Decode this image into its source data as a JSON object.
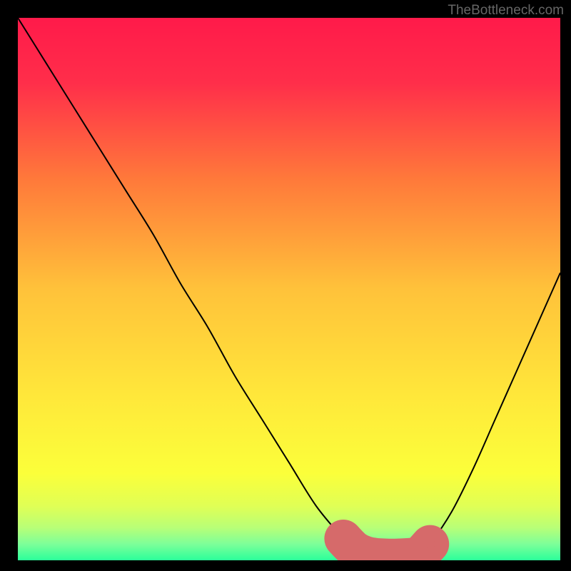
{
  "watermark": "TheBottleneck.com",
  "chart_data": {
    "type": "line",
    "title": "",
    "xlabel": "",
    "ylabel": "",
    "xlim": [
      0,
      100
    ],
    "ylim": [
      0,
      100
    ],
    "background_gradient": {
      "stops": [
        {
          "pos": 0.0,
          "color": "#ff1a4a"
        },
        {
          "pos": 0.12,
          "color": "#ff2e4a"
        },
        {
          "pos": 0.3,
          "color": "#ff7a3a"
        },
        {
          "pos": 0.5,
          "color": "#ffc23a"
        },
        {
          "pos": 0.7,
          "color": "#ffe83a"
        },
        {
          "pos": 0.84,
          "color": "#fbff3a"
        },
        {
          "pos": 0.9,
          "color": "#e0ff55"
        },
        {
          "pos": 0.94,
          "color": "#b8ff77"
        },
        {
          "pos": 0.97,
          "color": "#7dff99"
        },
        {
          "pos": 1.0,
          "color": "#2bff9a"
        }
      ]
    },
    "series": [
      {
        "name": "bottleneck-curve",
        "color": "#000000",
        "width": 2,
        "x": [
          0,
          5,
          10,
          15,
          20,
          25,
          30,
          35,
          40,
          45,
          50,
          55,
          60,
          62,
          64,
          66,
          68,
          70,
          72,
          74,
          76,
          80,
          84,
          88,
          92,
          96,
          100
        ],
        "y": [
          100,
          92,
          84,
          76,
          68,
          60,
          51,
          43,
          34,
          26,
          18,
          10,
          4,
          2,
          1,
          0.6,
          0.5,
          0.5,
          0.6,
          1,
          3,
          9,
          17,
          26,
          35,
          44,
          53
        ]
      }
    ],
    "highlight": {
      "name": "optimal-zone",
      "color": "#d66a6a",
      "width": 7,
      "x": [
        60,
        62,
        64,
        66,
        68,
        70,
        72,
        74,
        76
      ],
      "y": [
        4,
        2,
        1,
        0.6,
        0.5,
        0.5,
        0.6,
        1,
        3
      ]
    }
  }
}
